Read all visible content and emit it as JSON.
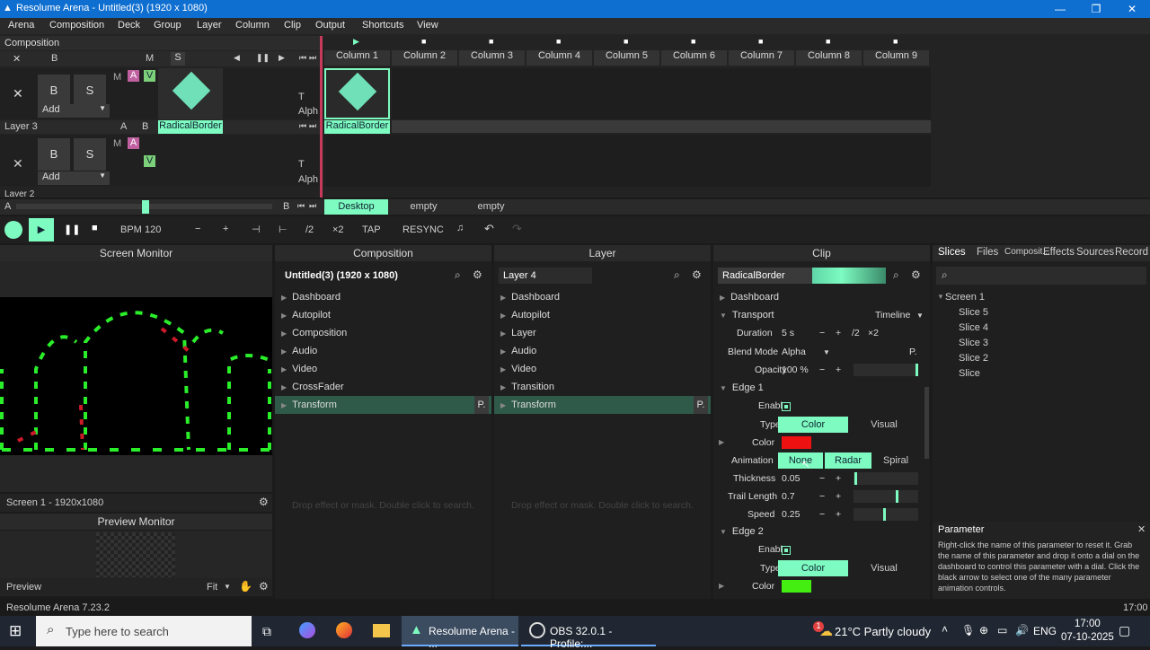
{
  "window": {
    "title": "Resolume Arena - Untitled(3) (1920 x 1080)"
  },
  "menu": [
    "Arena",
    "Composition",
    "Deck",
    "Group",
    "Layer",
    "Column",
    "Clip",
    "Output",
    "Shortcuts",
    "View"
  ],
  "deck": {
    "composition_label": "Composition",
    "columns": [
      "Column 1",
      "Column 2",
      "Column 3",
      "Column 4",
      "Column 5",
      "Column 6",
      "Column 7",
      "Column 8",
      "Column 9"
    ],
    "layer_label": "Layer 3",
    "layer2_label": "Layer 2",
    "add_label": "Add",
    "clip_name": "RadicalBorder",
    "b": "B",
    "s": "S",
    "m": "M",
    "a": "A",
    "v": "V",
    "t": "T",
    "alph": "Alph",
    "x": "✕"
  },
  "decks_bar": {
    "a": "A",
    "b": "B",
    "tabs": [
      "Desktop",
      "empty",
      "empty"
    ]
  },
  "transport": {
    "bpm_label": "BPM",
    "bpm": "120",
    "minus": "−",
    "plus": "+",
    "half": "/2",
    "double": "×2",
    "tap": "TAP",
    "resync": "RESYNC"
  },
  "screen_monitor": {
    "title": "Screen Monitor",
    "screen_label": "Screen 1 - 1920x1080",
    "preview_title": "Preview Monitor",
    "preview_label": "Preview",
    "fit": "Fit"
  },
  "composition_panel": {
    "title": "Composition",
    "name": "Untitled(3) (1920 x 1080)",
    "items": [
      "Dashboard",
      "Autopilot",
      "Composition",
      "Audio",
      "Video",
      "CrossFader",
      "Transform"
    ],
    "hint": "Drop effect or mask. Double click to search."
  },
  "layer_panel": {
    "title": "Layer",
    "name": "Layer 4",
    "items": [
      "Dashboard",
      "Autopilot",
      "Layer",
      "Audio",
      "Video",
      "Transition",
      "Transform"
    ],
    "hint": "Drop effect or mask. Double click to search."
  },
  "p_label": "P.",
  "clip_panel": {
    "title": "Clip",
    "name": "RadicalBorder",
    "dashboard": "Dashboard",
    "transport": "Transport",
    "timeline": "Timeline",
    "duration_label": "Duration",
    "duration": "5 s",
    "half": "/2",
    "double": "×2",
    "blend_label": "Blend Mode",
    "blend": "Alpha",
    "opacity_label": "Opacity",
    "opacity": "100 %",
    "opacity_level": 1.0,
    "edge1": "Edge 1",
    "enable": "Enable",
    "type_label": "Type",
    "type_color": "Color",
    "type_visual": "Visual",
    "color_label": "Color",
    "edge1_color": "#ee1111",
    "animation_label": "Animation",
    "anim_none": "None",
    "anim_radar": "Radar",
    "anim_spiral": "Spiral",
    "thickness_label": "Thickness",
    "thickness": "0.05",
    "thickness_level": 0.05,
    "trail_label": "Trail Length",
    "trail": "0.7",
    "trail_level": 0.7,
    "speed_label": "Speed",
    "speed": "0.25",
    "speed_level": 0.5,
    "edge2": "Edge 2",
    "edge2_color": "#44ee11"
  },
  "right_tabs": [
    "Slices",
    "Files",
    "Composit...",
    "Effects",
    "Sources",
    "Record"
  ],
  "slices": {
    "screen": "Screen 1",
    "items": [
      "Slice 5",
      "Slice 4",
      "Slice 3",
      "Slice 2",
      "Slice"
    ]
  },
  "parameter": {
    "title": "Parameter",
    "text": "Right-click the name of this parameter to reset it. Grab the name of this parameter and drop it onto a dial on the dashboard to control this parameter with a dial. Click the black arrow to select one of the many parameter animation controls."
  },
  "status": {
    "left": "Resolume Arena 7.23.2",
    "right": "17:00"
  },
  "taskbar": {
    "search": "Type here to search",
    "app1": "Resolume Arena - ...",
    "app2": "OBS 32.0.1 - Profile:...",
    "weather": "21°C  Partly cloudy",
    "lang": "ENG",
    "time": "17:00",
    "date": "07-10-2025",
    "badge": "1"
  },
  "colors": {
    "accent": "#7dfbc0",
    "titlebar": "#0f6fd0"
  }
}
